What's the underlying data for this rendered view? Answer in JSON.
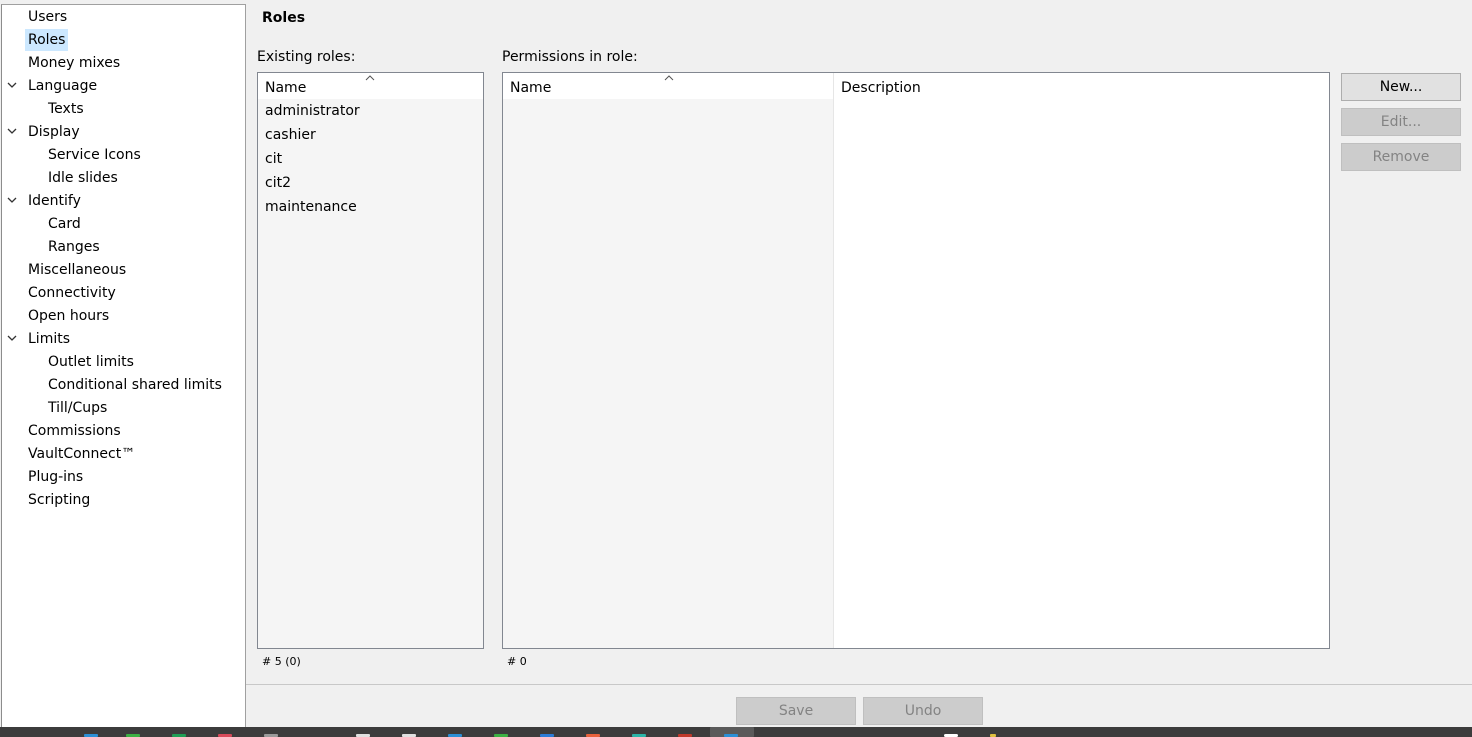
{
  "nav": {
    "items": [
      {
        "label": "Users",
        "level": 0,
        "expandable": false
      },
      {
        "label": "Roles",
        "level": 0,
        "expandable": false,
        "selected": true
      },
      {
        "label": "Money mixes",
        "level": 0,
        "expandable": false
      },
      {
        "label": "Language",
        "level": 0,
        "expandable": true
      },
      {
        "label": "Texts",
        "level": 1,
        "expandable": false
      },
      {
        "label": "Display",
        "level": 0,
        "expandable": true
      },
      {
        "label": "Service Icons",
        "level": 1,
        "expandable": false
      },
      {
        "label": "Idle slides",
        "level": 1,
        "expandable": false
      },
      {
        "label": "Identify",
        "level": 0,
        "expandable": true
      },
      {
        "label": "Card",
        "level": 1,
        "expandable": false
      },
      {
        "label": "Ranges",
        "level": 1,
        "expandable": false
      },
      {
        "label": "Miscellaneous",
        "level": 0,
        "expandable": false
      },
      {
        "label": "Connectivity",
        "level": 0,
        "expandable": false
      },
      {
        "label": "Open hours",
        "level": 0,
        "expandable": false
      },
      {
        "label": "Limits",
        "level": 0,
        "expandable": true
      },
      {
        "label": "Outlet limits",
        "level": 1,
        "expandable": false
      },
      {
        "label": "Conditional shared limits",
        "level": 1,
        "expandable": false
      },
      {
        "label": "Till/Cups",
        "level": 1,
        "expandable": false
      },
      {
        "label": "Commissions",
        "level": 0,
        "expandable": false
      },
      {
        "label": "VaultConnect™",
        "level": 0,
        "expandable": false
      },
      {
        "label": "Plug-ins",
        "level": 0,
        "expandable": false
      },
      {
        "label": "Scripting",
        "level": 0,
        "expandable": false
      }
    ]
  },
  "page": {
    "title": "Roles"
  },
  "existing_roles": {
    "label": "Existing roles:",
    "column": "Name",
    "rows": [
      "administrator",
      "cashier",
      "cit",
      "cit2",
      "maintenance"
    ],
    "count": "#  5 (0)"
  },
  "permissions": {
    "label": "Permissions in role:",
    "columns": [
      "Name",
      "Description"
    ],
    "count": "#  0"
  },
  "buttons": {
    "new": "New...",
    "edit": "Edit...",
    "remove": "Remove",
    "save": "Save",
    "undo": "Undo"
  },
  "colors": {
    "selection": "#cce8ff",
    "disabled_button": "#cccccc",
    "button": "#e1e1e1"
  }
}
